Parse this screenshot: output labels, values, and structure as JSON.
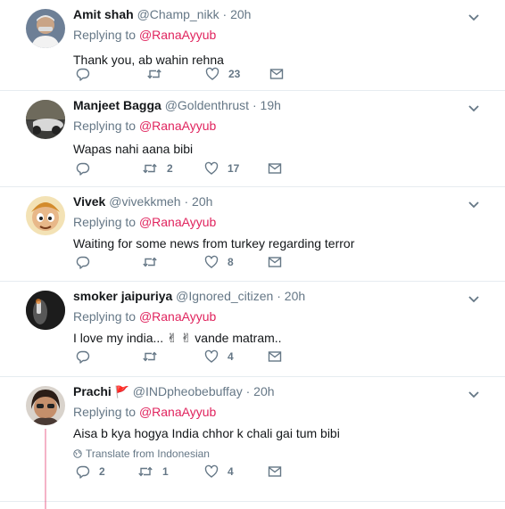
{
  "replying_prefix": "Replying to",
  "tweets": [
    {
      "name": "Amit shah",
      "handle": "@Champ_nikk",
      "time": "20h",
      "reply_to": "@RanaAyyub",
      "text": "Thank you, ab wahin rehna",
      "reply_count": "",
      "retweet_count": "",
      "like_count": "23"
    },
    {
      "name": "Manjeet Bagga",
      "handle": "@Goldenthrust",
      "time": "19h",
      "reply_to": "@RanaAyyub",
      "text": "Wapas nahi aana bibi",
      "reply_count": "",
      "retweet_count": "2",
      "like_count": "17"
    },
    {
      "name": "Vivek",
      "handle": "@vivekkmeh",
      "time": "20h",
      "reply_to": "@RanaAyyub",
      "text": "Waiting for some news from turkey regarding terror",
      "reply_count": "",
      "retweet_count": "",
      "like_count": "8"
    },
    {
      "name": "smoker jaipuriya",
      "handle": "@Ignored_citizen",
      "time": "20h",
      "reply_to": "@RanaAyyub",
      "text": "I love my india... ✌ ✌ vande matram..",
      "reply_count": "",
      "retweet_count": "",
      "like_count": "4"
    },
    {
      "name": "Prachi",
      "name_flag": "🚩",
      "handle": "@INDpheobebuffay",
      "time": "20h",
      "reply_to": "@RanaAyyub",
      "text": "Aisa b kya hogya India chhor k chali gai tum bibi",
      "translate": "Translate from Indonesian",
      "reply_count": "2",
      "retweet_count": "1",
      "like_count": "4"
    }
  ],
  "colors": {
    "accent": "#e0245e",
    "muted": "#657786",
    "text": "#14171a",
    "border": "#e6ecf0"
  }
}
